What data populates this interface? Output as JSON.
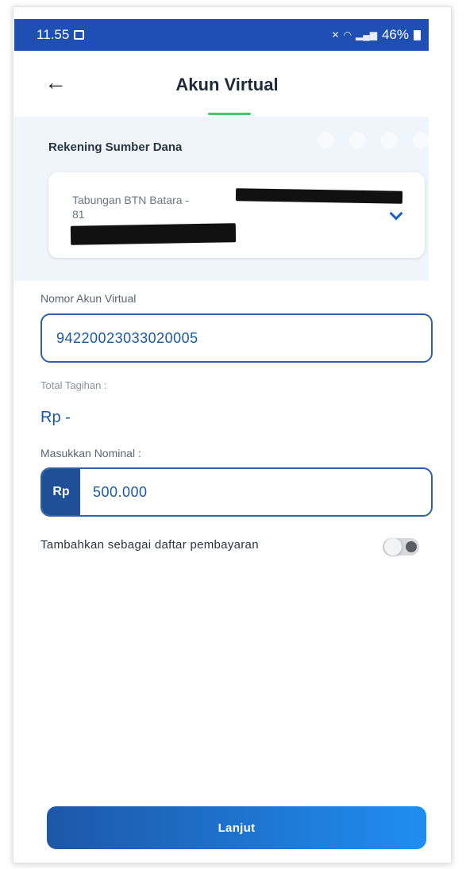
{
  "status_bar": {
    "time": "11.55",
    "battery_percent": "46%"
  },
  "header": {
    "title": "Akun Virtual"
  },
  "source_account": {
    "label": "Rekening Sumber Dana",
    "account_name_line1": "Tabungan BTN Batara -",
    "account_name_line2": "81"
  },
  "virtual_account": {
    "label": "Nomor Akun Virtual",
    "value": "94220023033020005"
  },
  "total_bill": {
    "label": "Total Tagihan :",
    "value": "Rp -"
  },
  "nominal": {
    "label": "Masukkan Nominal :",
    "prefix": "Rp",
    "value": "500.000"
  },
  "add_to_payment_list": {
    "label": "Tambahkan sebagai daftar pembayaran",
    "enabled": false
  },
  "continue_button": {
    "label": "Lanjut"
  },
  "colors": {
    "status_bar": "#1f4fb3",
    "primary_blue": "#1a58a6",
    "accent_green": "#4fc36a",
    "panel_bg": "#eff5fb"
  }
}
